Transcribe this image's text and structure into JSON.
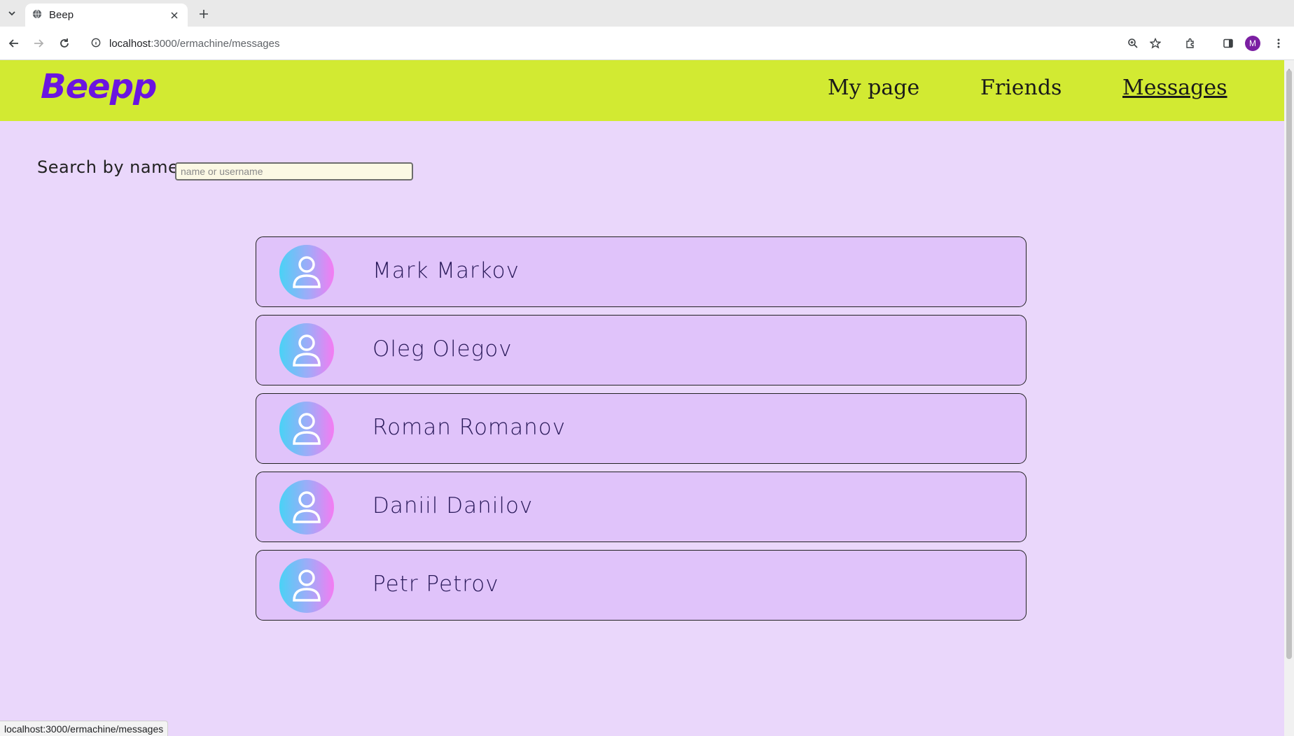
{
  "browser": {
    "tab_title": "Beep",
    "url_host": "localhost",
    "url_path": ":3000/ermachine/messages",
    "profile_initial": "M",
    "status_url": "localhost:3000/ermachine/messages"
  },
  "header": {
    "logo": "Beepp",
    "nav": [
      {
        "label": "My page",
        "active": false
      },
      {
        "label": "Friends",
        "active": false
      },
      {
        "label": "Messages",
        "active": true
      }
    ]
  },
  "search": {
    "label": "Search by name:",
    "placeholder": "name or username",
    "value": ""
  },
  "chats": [
    {
      "name": "Mark Markov"
    },
    {
      "name": "Oleg Olegov"
    },
    {
      "name": "Roman Romanov"
    },
    {
      "name": "Daniil Danilov"
    },
    {
      "name": "Petr Petrov"
    }
  ],
  "colors": {
    "header_bg": "#d2ea32",
    "page_bg": "#ead7fb",
    "card_bg": "#e0c3fa",
    "logo": "#6a14e0"
  },
  "icons": {
    "avatar": "user-avatar-icon"
  }
}
